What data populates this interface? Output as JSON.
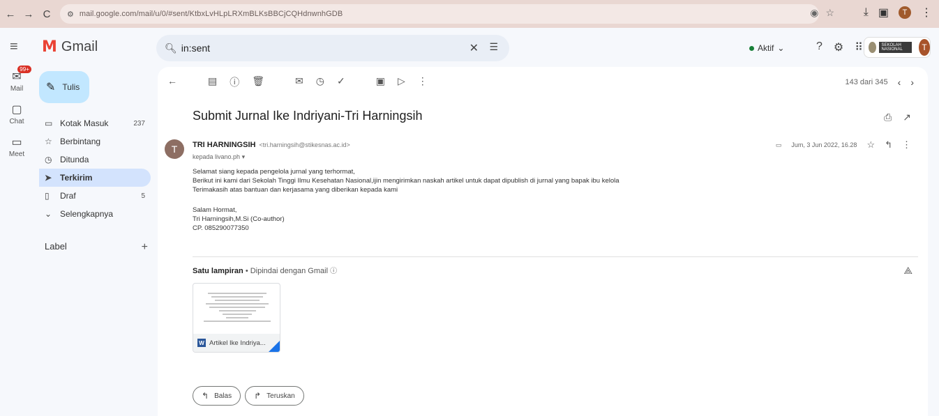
{
  "browser": {
    "url": "mail.google.com/mail/u/0/#sent/KtbxLvHLpLRXmBLKsBBCjCQHdnwnhGDB",
    "nav": [
      "←",
      "→",
      "C"
    ],
    "site_icon": "tune-icon",
    "url_icons": [
      "eye-icon",
      "star-icon"
    ],
    "right_icons": [
      "download-icon",
      "panel-icon",
      "extension-icon",
      "menu-icon"
    ],
    "profile_initial": "T"
  },
  "header": {
    "logo_text": "Gmail",
    "search_query": "in:sent",
    "status_label": "Aktif",
    "status_color": "#188038",
    "org_label": "SEKOLAH NASIONAL",
    "avatar_initial": "T"
  },
  "rail": [
    {
      "label": "Mail",
      "badge": "99+"
    },
    {
      "label": "Chat"
    },
    {
      "label": "Meet"
    }
  ],
  "sidebar": {
    "compose_label": "Tulis",
    "items": [
      {
        "label": "Kotak Masuk",
        "count": "237",
        "icon": "inbox-icon"
      },
      {
        "label": "Berbintang",
        "count": "",
        "icon": "star-icon"
      },
      {
        "label": "Ditunda",
        "count": "",
        "icon": "clock-icon"
      },
      {
        "label": "Terkirim",
        "count": "",
        "icon": "send-icon",
        "active": true
      },
      {
        "label": "Draf",
        "count": "5",
        "icon": "draft-icon"
      },
      {
        "label": "Selengkapnya",
        "count": "",
        "icon": "chevron-down-icon"
      }
    ],
    "label_heading": "Label"
  },
  "message": {
    "pager": "143 dari 345",
    "subject": "Submit Jurnal Ike Indriyani-Tri Harningsih",
    "sender_initial": "T",
    "sender_name": "TRI HARNINGSIH",
    "sender_email": "<tri.harningsih@stikesnas.ac.id>",
    "recipient": "kepada livano.ph",
    "date": "Jum, 3 Jun 2022, 16.28",
    "body": [
      "Selamat siang kepada pengelola jurnal yang terhormat,",
      "Berikut ini kami dari Sekolah Tinggi Ilmu Kesehatan Nasional,ijin mengirimkan naskah artikel untuk dapat dipublish di jurnal yang bapak ibu kelola",
      "Terimakasih atas bantuan dan kerjasama yang diberikan kepada kami"
    ],
    "signature": [
      "Salam Hormat,",
      "Tri Harningsih,M.Si  (Co-author)",
      "CP. 085290077350"
    ],
    "attachment_heading": "Satu lampiran",
    "attachment_scanned": "Dipindai dengan Gmail",
    "attachment_name": "Artikel Ike Indriya...",
    "reply_label": "Balas",
    "forward_label": "Teruskan"
  }
}
